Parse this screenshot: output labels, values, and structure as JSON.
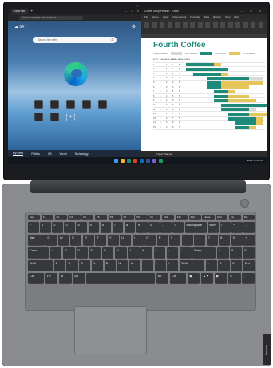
{
  "browser": {
    "tab_label": "New tab",
    "new_tab_icon": "plus-icon",
    "address_text": "Search or enter web address",
    "weather": "☁ 54 °",
    "search_placeholder": "Search the web",
    "news_tabs": [
      "My Feed",
      "Politics",
      "US",
      "World",
      "Technology"
    ],
    "tile_count": 8
  },
  "excel": {
    "window_title": "Coffee Shop Planner - Excel",
    "menu_tabs": [
      "File",
      "Home",
      "Insert",
      "Page Layout",
      "Formulas",
      "Data",
      "Review",
      "View",
      "Help"
    ],
    "sheet_title": "Fourth Coffee",
    "subtitle": "Project Planner",
    "sheet_tab": "Project Planner",
    "legend": [
      {
        "label": "Plan Duration",
        "color": "#d8d8d8"
      },
      {
        "label": "Actual Start",
        "color": "#1e8a7a"
      },
      {
        "label": "% Complete",
        "color": "#e6c55a"
      }
    ],
    "columns": [
      "ACTIVITY",
      "PLAN START",
      "PLAN DURATION",
      "ACTUAL START",
      "ACTUAL DURATION"
    ],
    "rows": [
      [
        "1",
        "1",
        "4",
        "1",
        "5"
      ],
      [
        "2",
        "1",
        "6",
        "1",
        "6"
      ],
      [
        "3",
        "2",
        "4",
        "2",
        "5"
      ],
      [
        "4",
        "4",
        "8",
        "4",
        "6"
      ],
      [
        "5",
        "4",
        "2",
        "4",
        "8"
      ],
      [
        "6",
        "4",
        "2",
        "4",
        "6"
      ],
      [
        "7",
        "5",
        "2",
        "5",
        "3"
      ],
      [
        "8",
        "5",
        "2",
        "5",
        "5"
      ],
      [
        "9",
        "5",
        "2",
        "5",
        "6"
      ],
      [
        "10",
        "6",
        "7",
        "6",
        "8"
      ],
      [
        "11",
        "6",
        "5",
        "6",
        "4"
      ],
      [
        "12",
        "7",
        "3",
        "7",
        "6"
      ],
      [
        "13",
        "7",
        "4",
        "7",
        "5"
      ],
      [
        "14",
        "8",
        "3",
        "8",
        "4"
      ],
      [
        "15",
        "8",
        "2",
        "8",
        "3"
      ]
    ]
  },
  "taskbar": {
    "tray_text": "ENG  12:45 PM",
    "icons": [
      "#3aa0e8",
      "#f2b134",
      "#1e8a7a",
      "#d24726",
      "#0f6cbd",
      "#2b579a",
      "#7b5bd6",
      "#1d9b5b"
    ]
  },
  "keyboard": {
    "rows": [
      [
        "Esc",
        "F1",
        "F2",
        "F3",
        "F4",
        "F5",
        "F6",
        "F7",
        "F8",
        "F9",
        "F10",
        "F11",
        "F12",
        "Home",
        "End",
        "Ins",
        "Del"
      ],
      [
        "~",
        "1",
        "2",
        "3",
        "4",
        "5",
        "6",
        "7",
        "8",
        "9",
        "0",
        "-",
        "=",
        "Backspace",
        "Num",
        "/",
        "*",
        "-"
      ],
      [
        "Tab",
        "Q",
        "W",
        "E",
        "R",
        "T",
        "Y",
        "U",
        "I",
        "O",
        "P",
        "[",
        "]",
        "\\",
        "7",
        "8",
        "9",
        "+"
      ],
      [
        "Caps",
        "A",
        "S",
        "D",
        "F",
        "G",
        "H",
        "J",
        "K",
        "L",
        ";",
        "'",
        "Enter",
        "4",
        "5",
        "6"
      ],
      [
        "Shift",
        "Z",
        "X",
        "C",
        "V",
        "B",
        "N",
        "M",
        ",",
        ".",
        "/",
        "Shift",
        "1",
        "2",
        "3",
        "Ent"
      ],
      [
        "Ctrl",
        "Fn",
        "⊞",
        "Alt",
        "",
        "Alt",
        "Ctrl",
        "◀",
        "▲▼",
        "▶",
        "0",
        "."
      ]
    ]
  },
  "brand": "Lenovo"
}
